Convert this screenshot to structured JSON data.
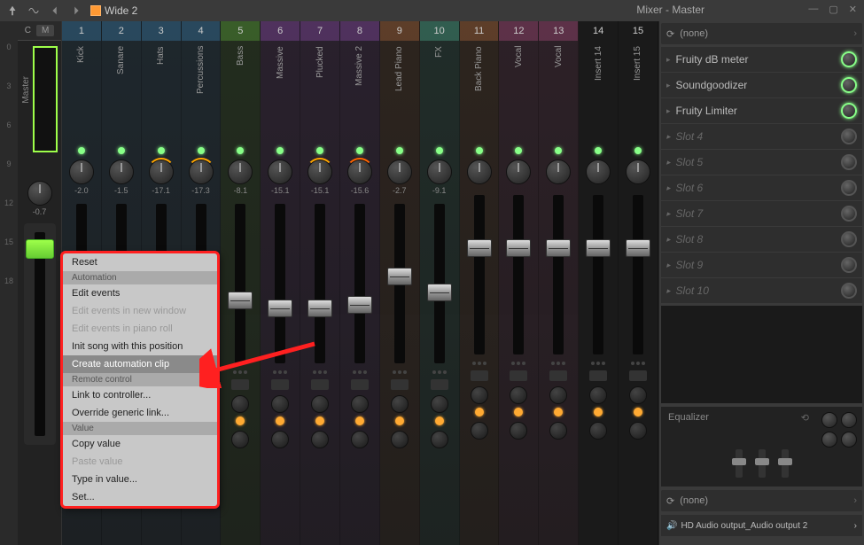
{
  "window": {
    "title": "Mixer - Master"
  },
  "preset": {
    "name": "Wide 2"
  },
  "master": {
    "label": "M",
    "name": "Master",
    "pan_value": "-0.7",
    "current_label": "C"
  },
  "scale_marks": [
    "0",
    "3",
    "6",
    "9",
    "12",
    "15",
    "18"
  ],
  "tracks": [
    {
      "num": "1",
      "name": "Kick",
      "pan": "-2.0",
      "color": "#3a7aa5",
      "fader": 62
    },
    {
      "num": "2",
      "name": "Sanare",
      "pan": "-1.5",
      "color": "#3a7aa5",
      "fader": 58
    },
    {
      "num": "3",
      "name": "Hats",
      "pan": "-17.1",
      "color": "#3a7aa5",
      "fader": 42,
      "arc": "#ffa500"
    },
    {
      "num": "4",
      "name": "Percussions",
      "pan": "-17.3",
      "color": "#3a7aa5",
      "fader": 38,
      "arc": "#ffa500"
    },
    {
      "num": "5",
      "name": "Bass",
      "pan": "-8.1",
      "color": "#5aa53a",
      "fader": 45
    },
    {
      "num": "6",
      "name": "Massive",
      "pan": "-15.1",
      "color": "#8a4aa5",
      "fader": 40
    },
    {
      "num": "7",
      "name": "Plucked",
      "pan": "-15.1",
      "color": "#8a4aa5",
      "fader": 40,
      "arc": "#ffa500"
    },
    {
      "num": "8",
      "name": "Massive 2",
      "pan": "-15.6",
      "color": "#8a4aa5",
      "fader": 42,
      "arc": "#ff6600"
    },
    {
      "num": "9",
      "name": "Lead Piano",
      "pan": "-2.7",
      "color": "#a5653a",
      "fader": 60
    },
    {
      "num": "10",
      "name": "FX",
      "pan": "-9.1",
      "color": "#4aa58a",
      "fader": 50
    },
    {
      "num": "11",
      "name": "Back Piano",
      "pan": "",
      "color": "#a5653a",
      "fader": 72
    },
    {
      "num": "12",
      "name": "Vocal",
      "pan": "",
      "color": "#a54a7a",
      "fader": 72
    },
    {
      "num": "13",
      "name": "Vocal",
      "pan": "",
      "color": "#a54a7a",
      "fader": 72
    },
    {
      "num": "14",
      "name": "Insert 14",
      "pan": "",
      "color": "#555",
      "fader": 72
    },
    {
      "num": "15",
      "name": "Insert 15",
      "pan": "",
      "color": "#555",
      "fader": 72
    }
  ],
  "input_slot": {
    "label": "(none)"
  },
  "fx_slots": [
    {
      "name": "Fruity dB meter",
      "on": true
    },
    {
      "name": "Soundgoodizer",
      "on": true
    },
    {
      "name": "Fruity Limiter",
      "on": true
    },
    {
      "name": "Slot 4",
      "on": false
    },
    {
      "name": "Slot 5",
      "on": false
    },
    {
      "name": "Slot 6",
      "on": false
    },
    {
      "name": "Slot 7",
      "on": false
    },
    {
      "name": "Slot 8",
      "on": false
    },
    {
      "name": "Slot 9",
      "on": false
    },
    {
      "name": "Slot 10",
      "on": false
    }
  ],
  "equalizer": {
    "label": "Equalizer"
  },
  "output_slot_none": {
    "label": "(none)"
  },
  "output_slot": {
    "label": "HD Audio output_Audio output 2"
  },
  "context_menu": {
    "reset": "Reset",
    "sec_automation": "Automation",
    "edit_events": "Edit events",
    "edit_events_new": "Edit events in new window",
    "edit_events_piano": "Edit events in piano roll",
    "init_song": "Init song with this position",
    "create_clip": "Create automation clip",
    "sec_remote": "Remote control",
    "link_controller": "Link to controller...",
    "override_link": "Override generic link...",
    "sec_value": "Value",
    "copy_value": "Copy value",
    "paste_value": "Paste value",
    "type_value": "Type in value...",
    "set": "Set..."
  }
}
